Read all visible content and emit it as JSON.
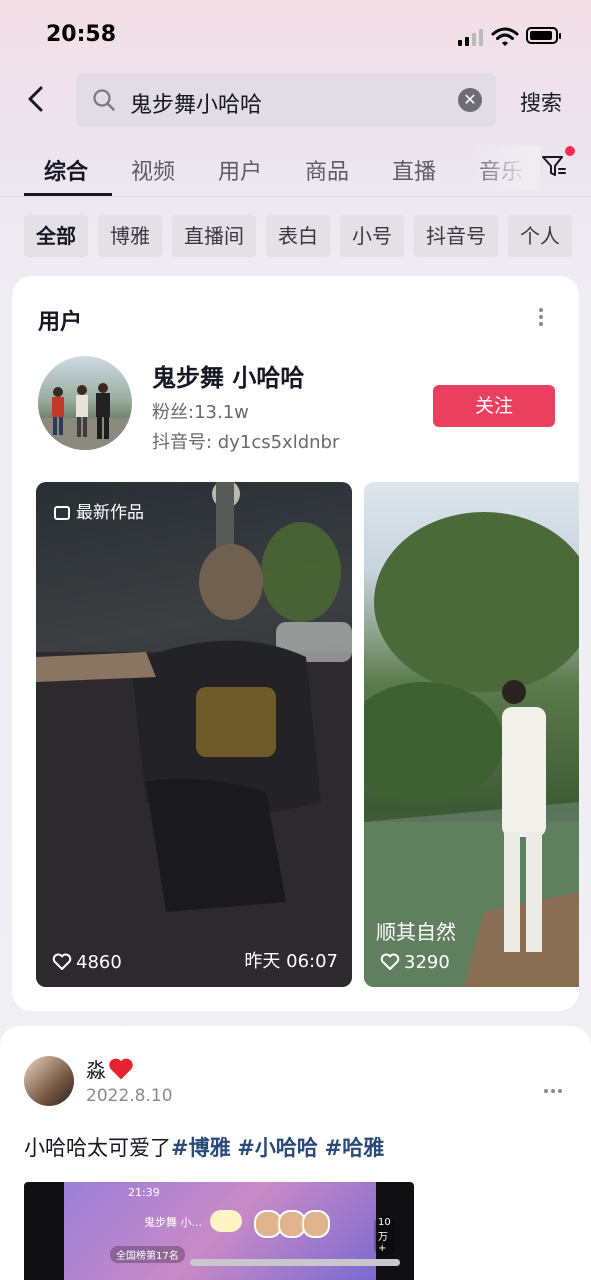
{
  "status_bar": {
    "time": "20:58"
  },
  "search": {
    "query": "鬼步舞小哈哈",
    "submit_label": "搜索"
  },
  "tabs": [
    "综合",
    "视频",
    "用户",
    "商品",
    "直播",
    "音乐"
  ],
  "chips": [
    "全部",
    "博雅",
    "直播间",
    "表白",
    "小号",
    "抖音号",
    "个人"
  ],
  "user_card": {
    "section_title": "用户",
    "name": "鬼步舞 小哈哈",
    "fans": "粉丝:13.1w",
    "douyin_id": "抖音号: dy1cs5xldnbr",
    "follow_label": "关注",
    "videos": [
      {
        "badge": "最新作品",
        "likes": "4860",
        "date": "昨天 06:07"
      },
      {
        "caption": "顺其自然",
        "likes": "3290"
      }
    ]
  },
  "post": {
    "author": "淼",
    "date": "2022.8.10",
    "text": "小哈哈太可爱了",
    "tags": [
      "#博雅",
      "#小哈哈",
      "#哈雅"
    ],
    "media": {
      "time": "21:39",
      "streamer": "鬼步舞 小...",
      "rank": "全国榜第17名",
      "viewers": "10万+"
    }
  },
  "colors": {
    "accent": "#ea3f5e",
    "notification_dot": "#fe2c55",
    "tag": "#2a4a7a"
  }
}
